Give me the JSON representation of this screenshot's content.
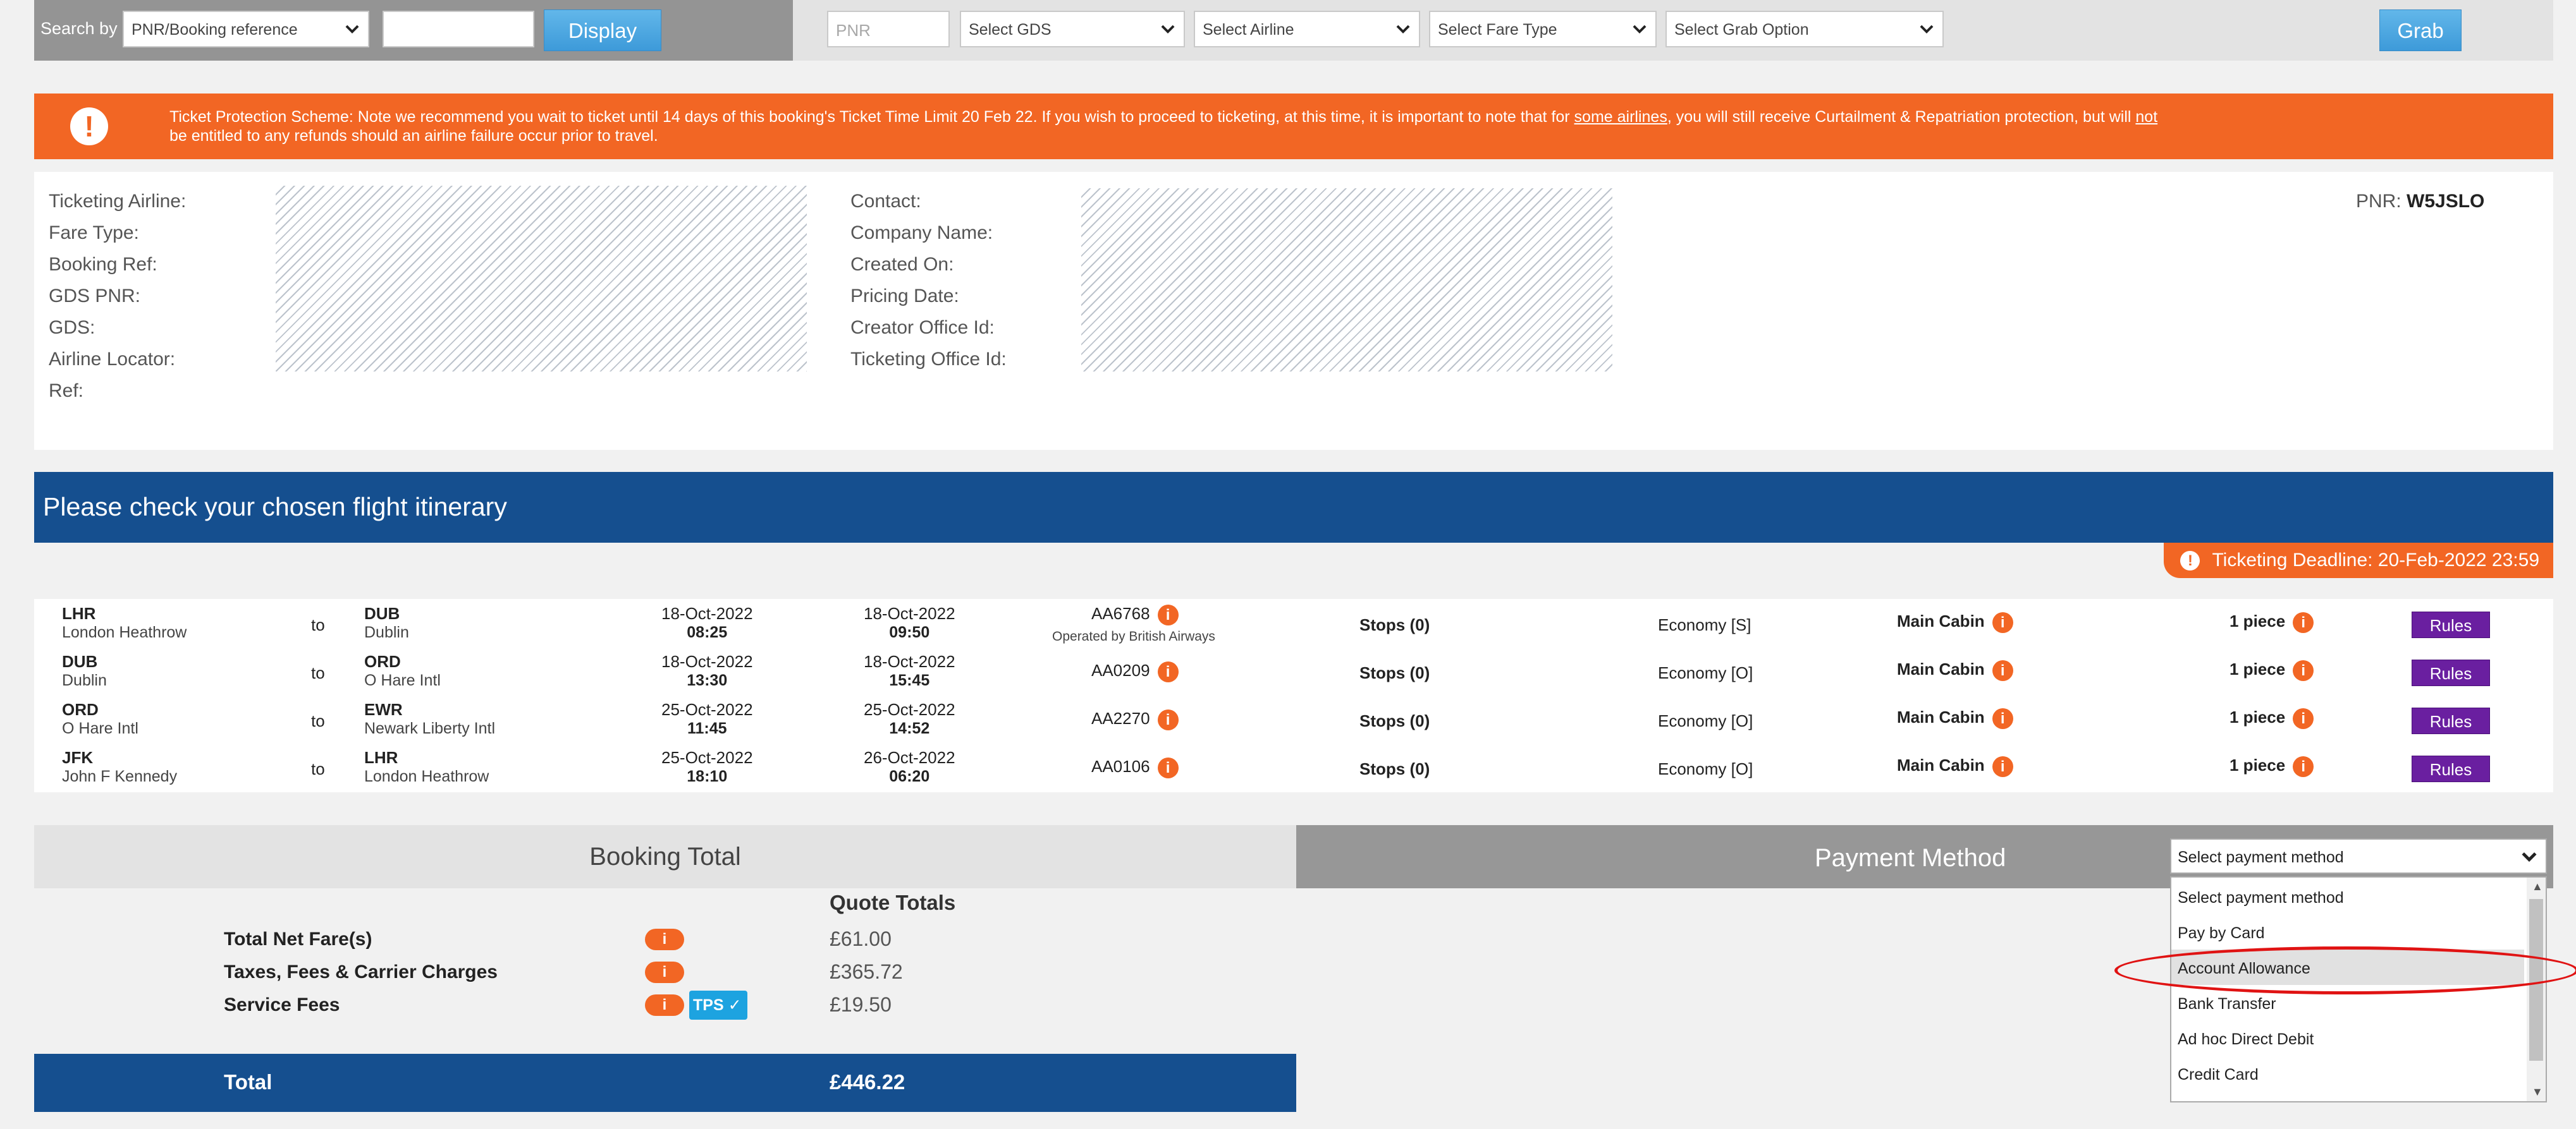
{
  "search": {
    "label": "Search by",
    "search_by_value": "PNR/Booking reference",
    "search_value": "",
    "display_button": "Display"
  },
  "grab": {
    "pnr_placeholder": "PNR",
    "gds_value": "Select GDS",
    "airline_value": "Select Airline",
    "fare_type_value": "Select Fare Type",
    "grab_option_value": "Select Grab Option",
    "grab_button": "Grab"
  },
  "alert": {
    "icon": "!",
    "text_1": "Ticket Protection Scheme: Note we recommend you wait to ticket until 14 days of this booking's Ticket Time Limit 20 Feb 22. If you wish to proceed to ticketing, at this time, it is important to note that for ",
    "link_some_airlines": "some airlines",
    "text_2": ", you will still receive Curtailment & Repatriation protection, but will ",
    "link_not": "not",
    "text_3": "be entitled to any refunds should an airline failure occur prior to travel."
  },
  "info": {
    "left_labels": [
      "Ticketing Airline:",
      "Fare Type:",
      "Booking Ref:",
      "GDS PNR:",
      "GDS:",
      "Airline Locator:",
      "Ref:"
    ],
    "mid_labels": [
      "Contact:",
      "Company Name:",
      "Created On:",
      "Pricing Date:",
      "Creator Office Id:",
      "Ticketing Office Id:"
    ],
    "pnr_label": "PNR:",
    "pnr_value": "W5JSLO"
  },
  "itinerary": {
    "title": "Please check your chosen flight itinerary",
    "deadline": "Ticketing Deadline: 20-Feb-2022 23:59",
    "to_label": "to",
    "flights": [
      {
        "from_code": "LHR",
        "from_name": "London Heathrow",
        "to_code": "DUB",
        "to_name": "Dublin",
        "dep_date": "18-Oct-2022",
        "dep_time": "08:25",
        "arr_date": "18-Oct-2022",
        "arr_time": "09:50",
        "flight": "AA6768",
        "operated": "Operated by British Airways",
        "stops": "Stops (0)",
        "cabin_class": "Economy",
        "booking_class": "[S]",
        "cabin": "Main Cabin",
        "baggage": "1 piece",
        "rules": "Rules"
      },
      {
        "from_code": "DUB",
        "from_name": "Dublin",
        "to_code": "ORD",
        "to_name": "O Hare Intl",
        "dep_date": "18-Oct-2022",
        "dep_time": "13:30",
        "arr_date": "18-Oct-2022",
        "arr_time": "15:45",
        "flight": "AA0209",
        "operated": "",
        "stops": "Stops (0)",
        "cabin_class": "Economy",
        "booking_class": "[O]",
        "cabin": "Main Cabin",
        "baggage": "1 piece",
        "rules": "Rules"
      },
      {
        "from_code": "ORD",
        "from_name": "O Hare Intl",
        "to_code": "EWR",
        "to_name": "Newark Liberty Intl",
        "dep_date": "25-Oct-2022",
        "dep_time": "11:45",
        "arr_date": "25-Oct-2022",
        "arr_time": "14:52",
        "flight": "AA2270",
        "operated": "",
        "stops": "Stops (0)",
        "cabin_class": "Economy",
        "booking_class": "[O]",
        "cabin": "Main Cabin",
        "baggage": "1 piece",
        "rules": "Rules"
      },
      {
        "from_code": "JFK",
        "from_name": "John F Kennedy",
        "to_code": "LHR",
        "to_name": "London Heathrow",
        "dep_date": "25-Oct-2022",
        "dep_time": "18:10",
        "arr_date": "26-Oct-2022",
        "arr_time": "06:20",
        "flight": "AA0106",
        "operated": "",
        "stops": "Stops (0)",
        "cabin_class": "Economy",
        "booking_class": "[O]",
        "cabin": "Main Cabin",
        "baggage": "1 piece",
        "rules": "Rules"
      }
    ]
  },
  "booking_total": {
    "title": "Booking Total",
    "quote_header": "Quote Totals",
    "rows": [
      {
        "label": "Total Net Fare(s)",
        "value": "£61.00"
      },
      {
        "label": "Taxes, Fees & Carrier Charges",
        "value": "£365.72"
      },
      {
        "label": "Service Fees",
        "value": "£19.50"
      }
    ],
    "info_badge": "i",
    "tps_badge": "TPS",
    "total_label": "Total",
    "total_value": "£446.22"
  },
  "payment": {
    "title": "Payment Method",
    "selected": "Select payment method",
    "options": [
      "Select payment method",
      "Pay by Card",
      "Account Allowance",
      "Bank Transfer",
      "Ad hoc Direct Debit",
      "Credit Card"
    ],
    "highlighted_index": 2
  },
  "colors": {
    "accent_orange": "#f26624",
    "banner_blue": "#154f8f",
    "rules_purple": "#6a1fa0",
    "annotation_red": "#e01313"
  }
}
